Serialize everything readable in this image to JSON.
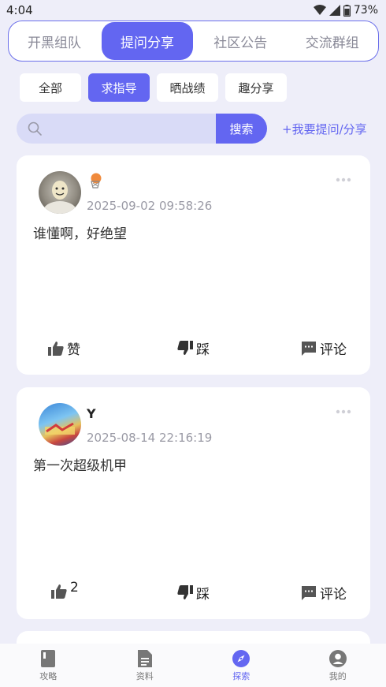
{
  "status_bar": {
    "time": "4:04",
    "battery": "73%"
  },
  "top_tabs": [
    {
      "label": "开黑组队",
      "active": false
    },
    {
      "label": "提问分享",
      "active": true
    },
    {
      "label": "社区公告",
      "active": false
    },
    {
      "label": "交流群组",
      "active": false
    }
  ],
  "filter_chips": [
    {
      "label": "全部",
      "active": false
    },
    {
      "label": "求指导",
      "active": true
    },
    {
      "label": "晒战绩",
      "active": false
    },
    {
      "label": "趣分享",
      "active": false
    }
  ],
  "search": {
    "placeholder": "",
    "button_label": "搜索",
    "ask_link": "+我要提问/分享"
  },
  "posts": [
    {
      "author": "",
      "time": "2025-09-02 09:58:26",
      "content": "谁懂啊，好绝望",
      "like_label": "赞",
      "dislike_label": "踩",
      "comment_label": "评论"
    },
    {
      "author": "Y",
      "time": "2025-08-14 22:16:19",
      "content": "第一次超级机甲",
      "like_label": "2",
      "dislike_label": "踩",
      "comment_label": "评论"
    }
  ],
  "bottom_nav": [
    {
      "label": "攻略",
      "icon": "book-icon",
      "active": false
    },
    {
      "label": "资料",
      "icon": "document-icon",
      "active": false
    },
    {
      "label": "探索",
      "icon": "compass-icon",
      "active": true
    },
    {
      "label": "我的",
      "icon": "profile-icon",
      "active": false
    }
  ],
  "colors": {
    "accent": "#6366f1",
    "background": "#eeeef9"
  }
}
